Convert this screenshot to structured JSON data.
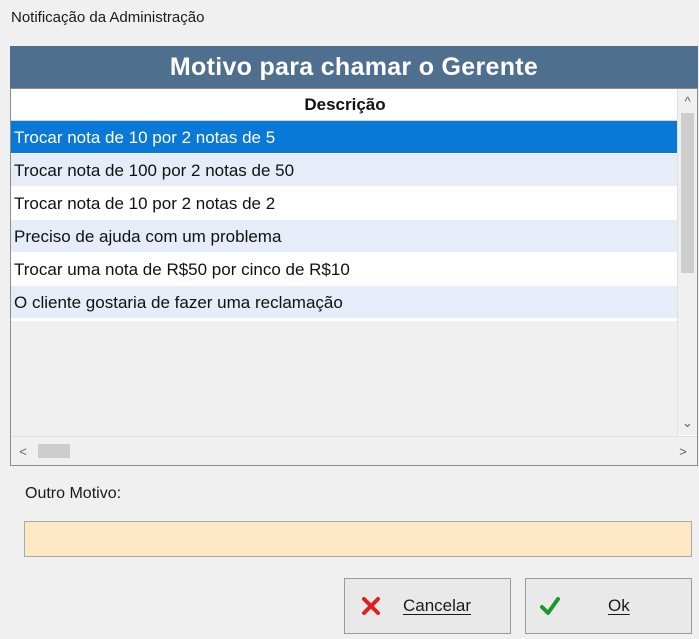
{
  "window": {
    "title": "Notificação da Administração"
  },
  "header": {
    "title": "Motivo para chamar o Gerente"
  },
  "grid": {
    "column_header": "Descrição",
    "rows": [
      {
        "text": "Trocar nota de 10 por 2 notas de 5",
        "selected": true
      },
      {
        "text": "Trocar nota de 100 por 2 notas de 50",
        "selected": false
      },
      {
        "text": "Trocar nota de 10 por 2 notas de 2",
        "selected": false
      },
      {
        "text": "Preciso de ajuda com um problema",
        "selected": false
      },
      {
        "text": "Trocar uma nota de R$50 por cinco de R$10",
        "selected": false
      },
      {
        "text": "O cliente gostaria de fazer uma reclamação",
        "selected": false
      }
    ],
    "scroll_up_glyph": "^",
    "scroll_down_glyph": "⌄",
    "scroll_left_glyph": "<",
    "scroll_right_glyph": ">"
  },
  "outro_motivo": {
    "label": "Outro Motivo:",
    "value": ""
  },
  "buttons": {
    "cancel_label": "Cancelar",
    "ok_label": "Ok"
  },
  "colors": {
    "header_bg": "#4f6f8f",
    "selected_row": "#0a78d7",
    "alt_row": "#e6ecf8",
    "input_bg": "#fde7c4",
    "cancel_icon": "#e02020",
    "ok_icon": "#1a9a2a"
  },
  "icons": {
    "cancel": "x-icon",
    "ok": "check-icon"
  }
}
